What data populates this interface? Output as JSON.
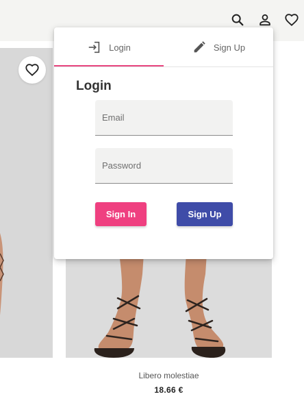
{
  "header": {
    "icons": [
      "search-icon",
      "account-icon",
      "wishlist-icon"
    ]
  },
  "colors": {
    "accent_pink": "#ef4080",
    "accent_indigo": "#3f4ca8",
    "tab_indicator": "#e8457f"
  },
  "popup": {
    "tabs": [
      {
        "label": "Login",
        "icon": "login-icon"
      },
      {
        "label": "Sign Up",
        "icon": "pencil-icon"
      }
    ],
    "title": "Login",
    "email_placeholder": "Email",
    "password_placeholder": "Password",
    "signin_label": "Sign In",
    "signup_label": "Sign Up"
  },
  "product": {
    "name": "Libero molestiae",
    "price": "18.66 €"
  }
}
